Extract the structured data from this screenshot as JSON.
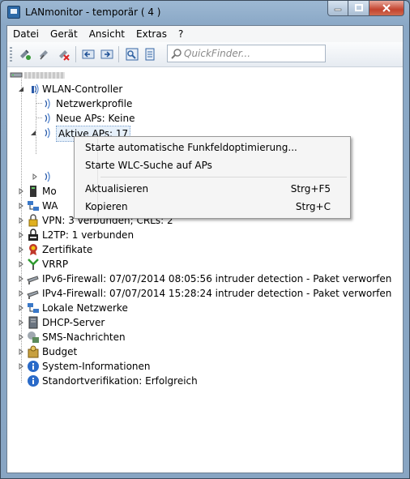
{
  "window": {
    "title": "LANmonitor - temporär ( 4 )"
  },
  "menu": [
    "Datei",
    "Gerät",
    "Ansicht",
    "Extras",
    "?"
  ],
  "search": {
    "placeholder": "QuickFinder..."
  },
  "tree": {
    "wlan_controller": "WLAN-Controller",
    "netzwerkprofile": "Netzwerkprofile",
    "neue_aps": "Neue APs: Keine",
    "aktive_aps": "Aktive APs: 17",
    "mo": "Mo",
    "wa": "WA",
    "vpn": "VPN: 3 verbunden; CRLs: 2",
    "l2tp": "L2TP: 1 verbunden",
    "zertifikate": "Zertifikate",
    "vrrp": "VRRP",
    "ipv6_firewall": "IPv6-Firewall: 07/07/2014 08:05:56 intruder detection - Paket verworfen",
    "ipv4_firewall": "IPv4-Firewall: 07/07/2014 15:28:24 intruder detection - Paket verworfen",
    "lokale_netzwerke": "Lokale Netzwerke",
    "dhcp": "DHCP-Server",
    "sms": "SMS-Nachrichten",
    "budget": "Budget",
    "sysinfo": "System-Informationen",
    "standort": "Standortverifikation: Erfolgreich"
  },
  "context_menu": {
    "item1": "Starte automatische Funkfeldoptimierung...",
    "item2": "Starte WLC-Suche auf APs",
    "item3": "Aktualisieren",
    "item3_shortcut": "Strg+F5",
    "item4": "Kopieren",
    "item4_shortcut": "Strg+C"
  }
}
